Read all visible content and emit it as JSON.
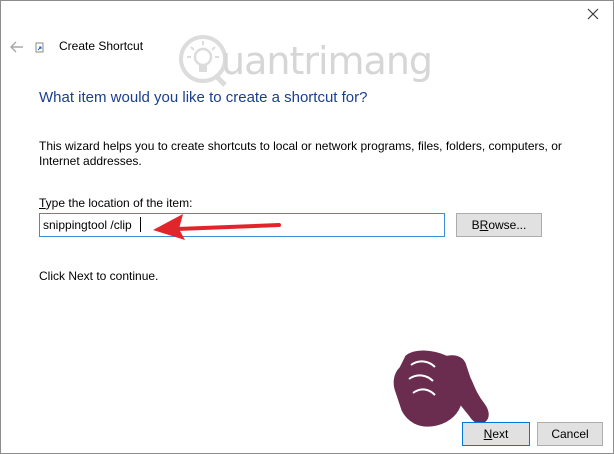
{
  "window": {
    "title": "Create Shortcut",
    "close_icon": "close-icon",
    "back_icon": "back-arrow-icon"
  },
  "watermark": {
    "text": "uantrimang",
    "logo_letter": "Q"
  },
  "wizard": {
    "heading": "What item would you like to create a shortcut for?",
    "description": "This wizard helps you to create shortcuts to local or network programs, files, folders, computers, or Internet addresses.",
    "location_label_hotkey": "T",
    "location_label_rest": "ype the location of the item:",
    "location_value": "snippingtool /clip",
    "continue_text": "Click Next to continue."
  },
  "buttons": {
    "browse_hotkey": "R",
    "browse_before": "B",
    "browse_after": "owse...",
    "next_hotkey": "N",
    "next_rest": "ext",
    "cancel_label": "Cancel"
  },
  "colors": {
    "heading": "#1a3f8c",
    "input_border": "#3c8fd6",
    "arrow": "#e0262b",
    "hand_fill": "#6b2d4f"
  }
}
